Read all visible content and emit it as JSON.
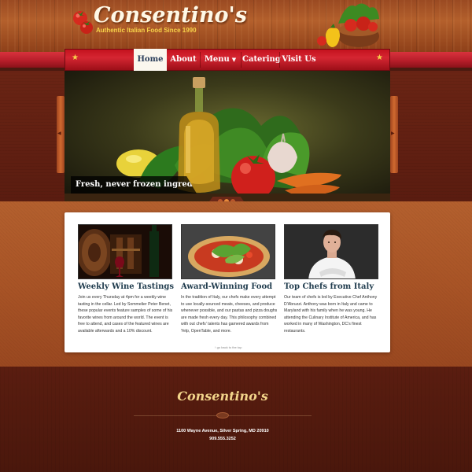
{
  "site": {
    "logo_text": "Consentino's",
    "tagline": "Authentic Italian Food Since 1990"
  },
  "nav": {
    "items": [
      {
        "label": "Home",
        "active": true
      },
      {
        "label": "About",
        "active": false
      },
      {
        "label": "Menu",
        "active": false,
        "has_dropdown": true
      },
      {
        "label": "Catering",
        "active": false
      },
      {
        "label": "Visit Us",
        "active": false
      }
    ],
    "star_glyph": "★"
  },
  "hero": {
    "caption": "Fresh, never frozen ingredients.",
    "slide_count": 3,
    "active_slide": 1
  },
  "features": [
    {
      "title": "Weekly Wine Tastings",
      "body": "Join us every Thursday at 4pm for a weekly wine tasting in the cellar. Led by Sommelier Peter Benet, these popular events feature samples of some of his favorite wines from around the world. The event is free to attend, and cases of the featured wines are available afterwards and a 10% discount.",
      "image_icon": "wine-barrel-image"
    },
    {
      "title": "Award-Winning Food",
      "body": "In the tradition of Italy, our chefs make every attempt to use locally-sourced meats, cheeses, and produce whenever possible, and our pastas and pizza doughs are made fresh every day. This philosophy combined with out chefs' talents has garnered awards from Yelp, OpenTable, and more.",
      "image_icon": "pizza-image"
    },
    {
      "title": "Top Chefs from Italy",
      "body": "Our team of chefs is led by Executive Chef Anthony D'Abruzzi. Anthony was born in Italy and came to Maryland with his family when he was young. He attending the Culinary Institute of America, and has worked in many of Washington, DC's finest restaurants.",
      "image_icon": "chef-portrait-image"
    }
  ],
  "back_to_top": "↑ go back to the top",
  "footer": {
    "logo_text": "Consentino's",
    "address": "1100 Wayne Avenue, Silver Spring, MD 20910",
    "phone": "909.555.3252"
  },
  "colors": {
    "nav_red": "#c4121e",
    "active_tab_text": "#2a3d5a",
    "tagline_yellow": "#f7d24a",
    "feature_title": "#1f3b4d",
    "footer_logo": "#f2d48a"
  }
}
